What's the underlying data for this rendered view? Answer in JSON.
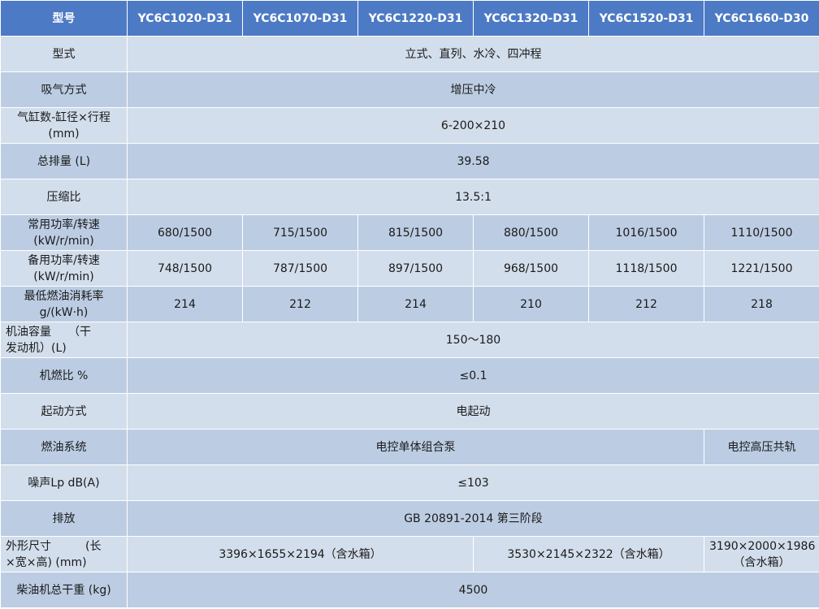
{
  "header": {
    "label": "型号",
    "models": [
      "YC6C1020-D31",
      "YC6C1070-D31",
      "YC6C1220-D31",
      "YC6C1320-D31",
      "YC6C1520-D31",
      "YC6C1660-D30"
    ]
  },
  "rows": {
    "type": {
      "label": "型式",
      "value": "立式、直列、水冷、四冲程"
    },
    "intake": {
      "label": "吸气方式",
      "value": "增压中冷"
    },
    "cylinders": {
      "label_line1": "气缸数-缸径×行程",
      "label_line2": "(mm)",
      "value": "6-200×210"
    },
    "displacement": {
      "label": "总排量 (L)",
      "value": "39.58"
    },
    "compression": {
      "label": "压缩比",
      "value": "13.5:1"
    },
    "prime_power": {
      "label_line1": "常用功率/转速",
      "label_line2": "(kW/r/min)",
      "values": [
        "680/1500",
        "715/1500",
        "815/1500",
        "880/1500",
        "1016/1500",
        "1110/1500"
      ]
    },
    "standby_power": {
      "label_line1": "备用功率/转速",
      "label_line2": "(kW/r/min)",
      "values": [
        "748/1500",
        "787/1500",
        "897/1500",
        "968/1500",
        "1118/1500",
        "1221/1500"
      ]
    },
    "fuel_consumption": {
      "label_line1": "最低燃油消耗率",
      "label_line2": "g/(kW·h)",
      "values": [
        "214",
        "212",
        "214",
        "210",
        "212",
        "218"
      ]
    },
    "oil_capacity": {
      "label_line1": "机油容量　　（干",
      "label_line2": "发动机）(L)",
      "value": "150～180"
    },
    "oil_fuel_ratio": {
      "label": "机燃比 %",
      "value": "≤0.1"
    },
    "start": {
      "label": "起动方式",
      "value": "电起动"
    },
    "fuel_system": {
      "label": "燃油系统",
      "value_main": "电控单体组合泵",
      "value_last": "电控高压共轨"
    },
    "noise": {
      "label": "噪声Lp dB(A)",
      "value": "≤103"
    },
    "emission": {
      "label": "排放",
      "value": "GB 20891-2014 第三阶段"
    },
    "dimensions": {
      "label_line1": "外形尺寸　　　(长",
      "label_line2": "×宽×高) (mm)",
      "value_a": "3396×1655×2194（含水箱）",
      "value_b": "3530×2145×2322（含水箱）",
      "value_c_line1": "3190×2000×1986",
      "value_c_line2": "（含水箱）"
    },
    "dry_weight": {
      "label": "柴油机总干重 (kg)",
      "value": "4500"
    }
  },
  "colors": {
    "header_bg": "#4d7ac4",
    "row_light": "#d3deec",
    "row_dark": "#bccde3",
    "header_text": "#ffffff"
  }
}
